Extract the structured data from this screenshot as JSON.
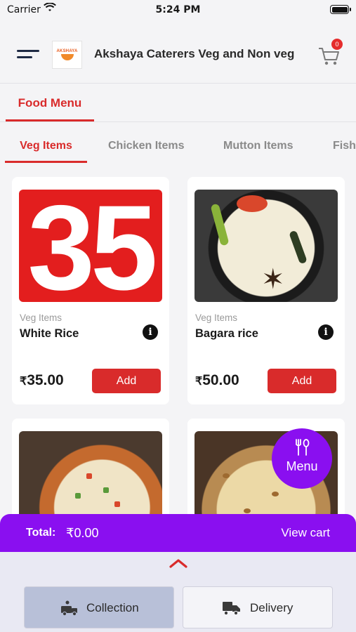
{
  "status_bar": {
    "carrier": "Carrier",
    "time": "5:24 PM"
  },
  "header": {
    "title": "Akshaya Caterers Veg and Non veg",
    "logo_text": "AKSHAYA",
    "cart_count": "0"
  },
  "section_tab": "Food Menu",
  "category_tabs": [
    "Veg Items",
    "Chicken Items",
    "Mutton Items",
    "Fish"
  ],
  "active_category": "Veg Items",
  "products": [
    {
      "image_text": "35",
      "category": "Veg Items",
      "name": "White Rice",
      "currency": "₹",
      "price": "35.00",
      "add_label": "Add"
    },
    {
      "category": "Veg Items",
      "name": "Bagara rice",
      "currency": "₹",
      "price": "50.00",
      "add_label": "Add"
    }
  ],
  "fab": {
    "label": "Menu"
  },
  "total_bar": {
    "total_label": "Total:",
    "total_value": "₹0.00",
    "view_cart": "View cart"
  },
  "delivery_options": [
    {
      "label": "Collection",
      "selected": true
    },
    {
      "label": "Delivery",
      "selected": false
    }
  ],
  "colors": {
    "primary_red": "#d92b2b",
    "purple": "#8a0ff0",
    "selected_option": "#b8c0d8"
  }
}
